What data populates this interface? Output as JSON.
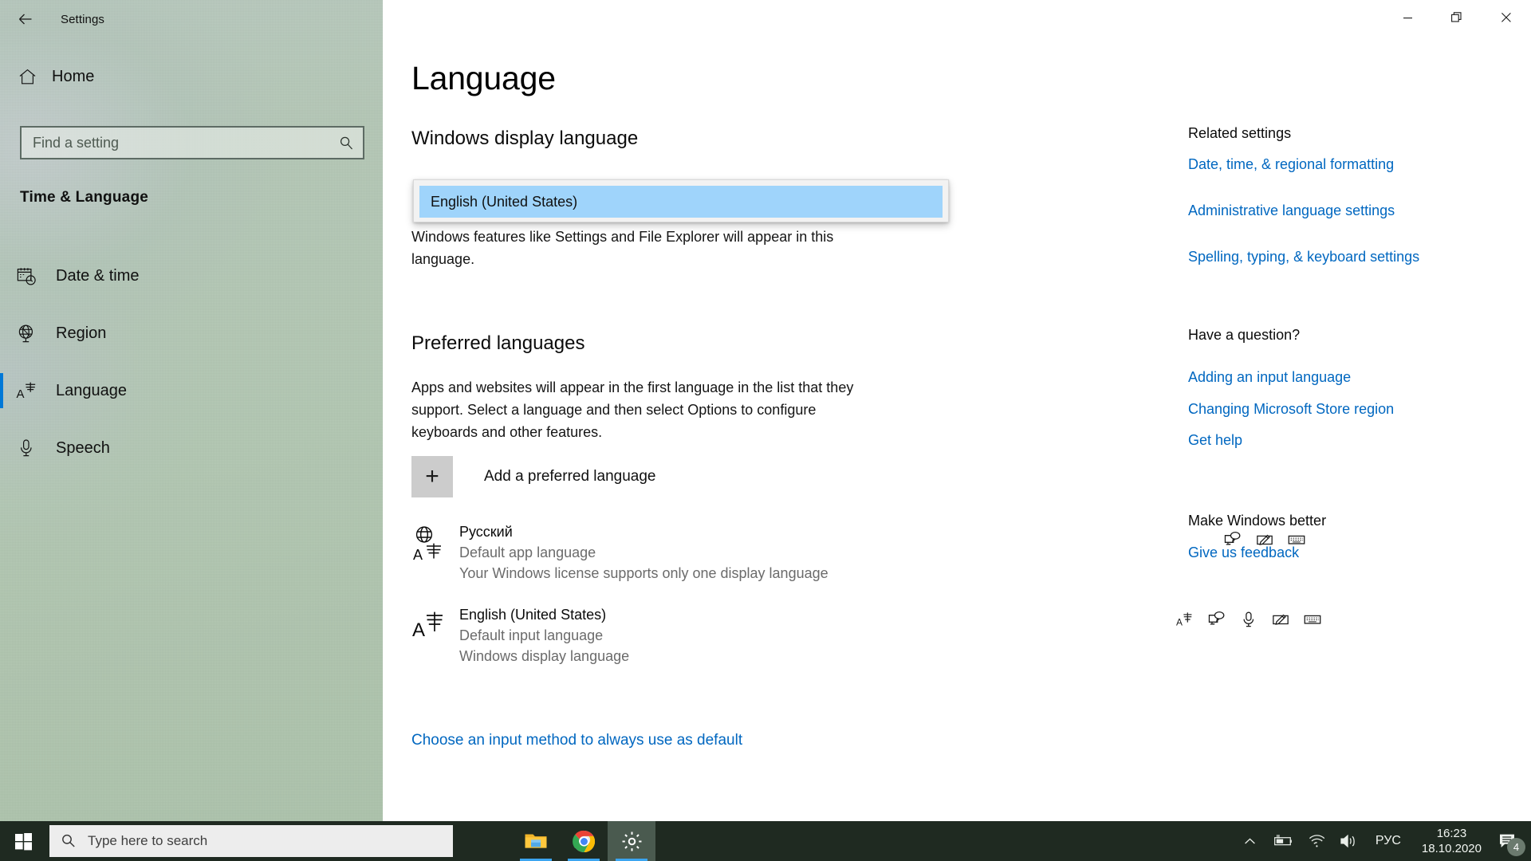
{
  "window": {
    "title": "Settings",
    "back_icon": "back-arrow-icon",
    "minimize_label": "Minimize",
    "restore_label": "Restore",
    "close_label": "Close"
  },
  "sidebar": {
    "home_label": "Home",
    "search_placeholder": "Find a setting",
    "search_value": "",
    "section_title": "Time & Language",
    "items": [
      {
        "label": "Date & time",
        "icon": "calendar-clock-icon",
        "selected": false
      },
      {
        "label": "Region",
        "icon": "globe-stand-icon",
        "selected": false
      },
      {
        "label": "Language",
        "icon": "language-icon",
        "selected": true
      },
      {
        "label": "Speech",
        "icon": "microphone-icon",
        "selected": false
      }
    ]
  },
  "main": {
    "page_title": "Language",
    "display_section": {
      "heading": "Windows display language",
      "selected_option": "English (United States)",
      "description": "Windows features like Settings and File Explorer will appear in this language."
    },
    "preferred_section": {
      "heading": "Preferred languages",
      "description": "Apps and websites will appear in the first language in the list that they support. Select a language and then select Options to configure keyboards and other features.",
      "add_label": "Add a preferred language",
      "add_icon": "plus-icon",
      "languages": [
        {
          "name": "Русский",
          "icon": "globe-translate-icon",
          "sub1": "Default app language",
          "sub2": "Your Windows license supports only one display language",
          "actions": [
            "display-icon",
            "handwriting-icon",
            "keyboard-icon"
          ]
        },
        {
          "name": "English (United States)",
          "icon": "language-pack-icon",
          "sub1": "Default input language",
          "sub2": "Windows display language",
          "actions": [
            "language-pack-icon",
            "display-icon",
            "microphone-icon",
            "handwriting-icon",
            "keyboard-icon"
          ]
        }
      ]
    },
    "bottom_link": "Choose an input method to always use as default"
  },
  "rail": {
    "related_heading": "Related settings",
    "related_links": [
      "Date, time, & regional formatting",
      "Administrative language settings",
      "Spelling, typing, & keyboard settings"
    ],
    "question_heading": "Have a question?",
    "question_links": [
      "Adding an input language",
      "Changing Microsoft Store region",
      "Get help"
    ],
    "better_heading": "Make Windows better",
    "better_links": [
      "Give us feedback"
    ]
  },
  "taskbar": {
    "start_icon": "windows-logo-icon",
    "search_placeholder": "Type here to search",
    "search_value": "",
    "apps": [
      {
        "name": "file-explorer",
        "running": true
      },
      {
        "name": "google-chrome",
        "running": true
      },
      {
        "name": "settings",
        "running": true
      }
    ],
    "tray": {
      "chevron_icon": "chevron-up-icon",
      "battery_icon": "battery-charging-icon",
      "wifi_icon": "wifi-icon",
      "volume_icon": "volume-icon",
      "input_language": "РУС",
      "time": "16:23",
      "date": "18.10.2020",
      "notifications_icon": "notification-icon",
      "notification_count": "4"
    }
  },
  "colors": {
    "accent": "#0078d7",
    "link": "#0067c0",
    "highlight": "#9fd4fb",
    "taskbar": "#1f2a21"
  }
}
